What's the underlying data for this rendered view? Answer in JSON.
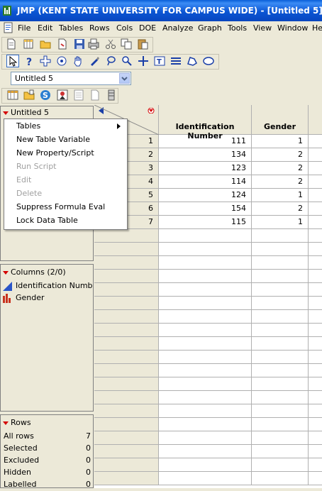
{
  "window": {
    "title": "JMP (KENT STATE UNIVERSITY FOR CAMPUS WIDE)  - [Untitled 5]"
  },
  "menubar": [
    "File",
    "Edit",
    "Tables",
    "Rows",
    "Cols",
    "DOE",
    "Analyze",
    "Graph",
    "Tools",
    "View",
    "Window",
    "He"
  ],
  "table_selector": {
    "value": "Untitled 5"
  },
  "table_panel": {
    "title": "Untitled 5"
  },
  "context_menu": {
    "items": [
      {
        "label": "Tables",
        "submenu": true,
        "enabled": true
      },
      {
        "label": "New Table Variable",
        "enabled": true
      },
      {
        "label": "New Property/Script",
        "enabled": true
      },
      {
        "label": "Run Script",
        "enabled": false
      },
      {
        "label": "Edit",
        "enabled": false
      },
      {
        "label": "Delete",
        "enabled": false
      },
      {
        "label": "Suppress Formula Eval",
        "enabled": true
      },
      {
        "label": "Lock Data Table",
        "enabled": true
      }
    ]
  },
  "columns_panel": {
    "title": "Columns (2/0)",
    "items": [
      {
        "name": "Identification Numb",
        "icon": "continuous-icon"
      },
      {
        "name": "Gender",
        "icon": "nominal-icon"
      }
    ]
  },
  "rows_panel": {
    "title": "Rows",
    "items": [
      {
        "label": "All rows",
        "value": "7"
      },
      {
        "label": "Selected",
        "value": "0"
      },
      {
        "label": "Excluded",
        "value": "0"
      },
      {
        "label": "Hidden",
        "value": "0"
      },
      {
        "label": "Labelled",
        "value": "0"
      }
    ]
  },
  "table": {
    "columns": [
      "Identification Number",
      "Gender"
    ],
    "rows": [
      {
        "row": "1",
        "id": "111",
        "gender": "1"
      },
      {
        "row": "2",
        "id": "134",
        "gender": "2"
      },
      {
        "row": "3",
        "id": "123",
        "gender": "2"
      },
      {
        "row": "4",
        "id": "114",
        "gender": "2"
      },
      {
        "row": "5",
        "id": "124",
        "gender": "1"
      },
      {
        "row": "6",
        "id": "154",
        "gender": "2"
      },
      {
        "row": "7",
        "id": "115",
        "gender": "1"
      }
    ]
  }
}
